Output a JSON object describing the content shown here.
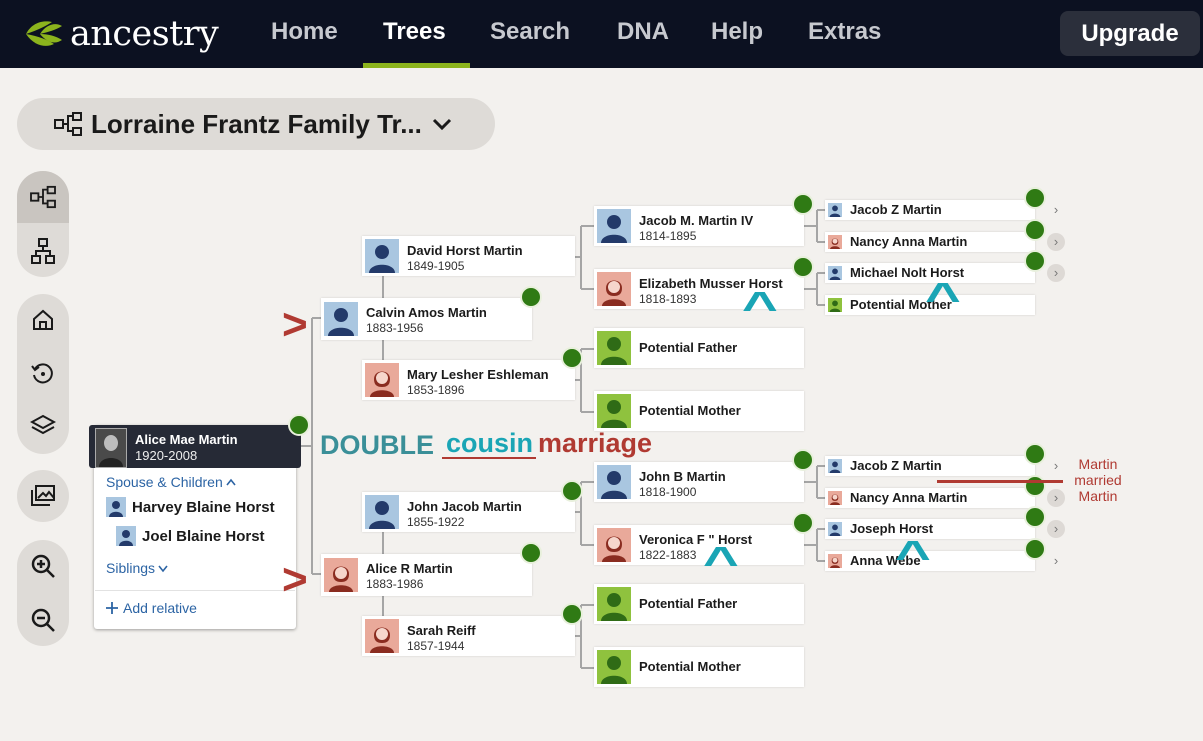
{
  "nav": {
    "brand": "ancestry",
    "links": [
      "Home",
      "Trees",
      "Search",
      "DNA",
      "Help",
      "Extras"
    ],
    "active": "Trees",
    "upgrade": "Upgrade"
  },
  "tree": {
    "title": "Lorraine Frantz Family Tr..."
  },
  "home_person": {
    "name": "Alice Mae Martin",
    "dates": "1920-2008",
    "spouse_children_label": "Spouse & Children",
    "spouses": [
      "Harvey Blaine Horst",
      "Joel Blaine Horst"
    ],
    "siblings_label": "Siblings",
    "add_relative": "Add relative"
  },
  "people": {
    "p_calvin": {
      "name": "Calvin Amos Martin",
      "dates": "1883-1956"
    },
    "p_alice_r": {
      "name": "Alice R Martin",
      "dates": "1883-1986"
    },
    "p_david": {
      "name": "David Horst Martin",
      "dates": "1849-1905"
    },
    "p_mary": {
      "name": "Mary Lesher Eshleman",
      "dates": "1853-1896"
    },
    "p_johnjacob": {
      "name": "John Jacob Martin",
      "dates": "1855-1922"
    },
    "p_sarah": {
      "name": "Sarah Reiff",
      "dates": "1857-1944"
    },
    "p_jacobm": {
      "name": "Jacob M. Martin IV",
      "dates": "1814-1895"
    },
    "p_elizabeth": {
      "name": "Elizabeth Musser Horst",
      "dates": "1818-1893"
    },
    "p_pf1": {
      "name": "Potential Father",
      "dates": ""
    },
    "p_pm1": {
      "name": "Potential Mother",
      "dates": ""
    },
    "p_johnb": {
      "name": "John B Martin",
      "dates": "1818-1900"
    },
    "p_veronica": {
      "name": "Veronica F \" Horst",
      "dates": "1822-1883"
    },
    "p_pf2": {
      "name": "Potential Father",
      "dates": ""
    },
    "p_pm2": {
      "name": "Potential Mother",
      "dates": ""
    },
    "g_jacobz1": {
      "name": "Jacob Z Martin"
    },
    "g_nancy1": {
      "name": "Nancy Anna Martin"
    },
    "g_michael": {
      "name": "Michael Nolt Horst"
    },
    "g_potmother": {
      "name": "Potential Mother"
    },
    "g_jacobz2": {
      "name": "Jacob Z Martin"
    },
    "g_nancy2": {
      "name": "Nancy Anna Martin"
    },
    "g_joseph": {
      "name": "Joseph Horst"
    },
    "g_anna": {
      "name": "Anna Webe"
    }
  },
  "annotations": {
    "double": "DOUBLE",
    "cousin": "cousin",
    "marriage": "marriage",
    "martin_married_martin": [
      "Martin",
      "married",
      "Martin"
    ],
    "arrow_marks": [
      ">",
      ">"
    ],
    "caret_marks": [
      "^",
      "^",
      "^",
      "^"
    ]
  },
  "colors": {
    "nav_bg": "#0c1121",
    "accent_green": "#8cb41d",
    "leaf_green": "#2f7a14",
    "annot_red": "#b03a32",
    "annot_teal": "#1aa5b5",
    "male_avatar": "#a9c6e0",
    "female_avatar": "#e9a99a",
    "unknown_avatar": "#8fc23e"
  },
  "icons": [
    "leaf-logo-icon",
    "tree-pedigree-icon",
    "tree-descendant-icon",
    "home-icon",
    "history-icon",
    "layers-icon",
    "gallery-icon",
    "zoom-in-icon",
    "zoom-out-icon",
    "chevron-down-icon",
    "hint-leaf-icon",
    "chevron-right-icon",
    "plus-icon"
  ]
}
